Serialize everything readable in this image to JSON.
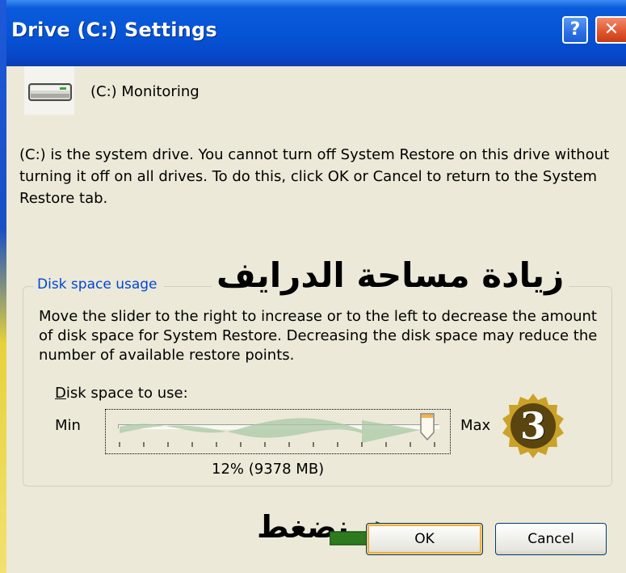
{
  "window": {
    "title": "Drive (C:) Settings",
    "help_label": "?",
    "close_label": "✕"
  },
  "drive": {
    "icon": "hard-drive-icon",
    "label": "(C:) Monitoring"
  },
  "description": "(C:) is the system drive. You cannot turn off System Restore on this drive without turning it off on all drives. To do this, click OK or Cancel to return to the System Restore tab.",
  "disk_usage": {
    "group_title": "Disk space usage",
    "annotation_title": "زيادة مساحة الدرايف",
    "description": "Move the slider to the right to increase or to the left to decrease the amount of disk space for System Restore. Decreasing the disk space may reduce the number of available restore points.",
    "space_label_accel": "D",
    "space_label_rest": "isk space to use:",
    "min_label": "Min",
    "max_label": "Max",
    "slider_fraction": 0.96,
    "usage_value": "12% (9378 MB)",
    "step_badge": "3"
  },
  "buttons": {
    "ok_label": "OK",
    "cancel_label": "Cancel",
    "press_annotation": "نضغط"
  },
  "colors": {
    "titlebar": "#0654d6",
    "group_title": "#0046d5",
    "dialog_bg": "#ece9d8",
    "badge": "#c9a227",
    "arrow": "#2d7a1f"
  }
}
